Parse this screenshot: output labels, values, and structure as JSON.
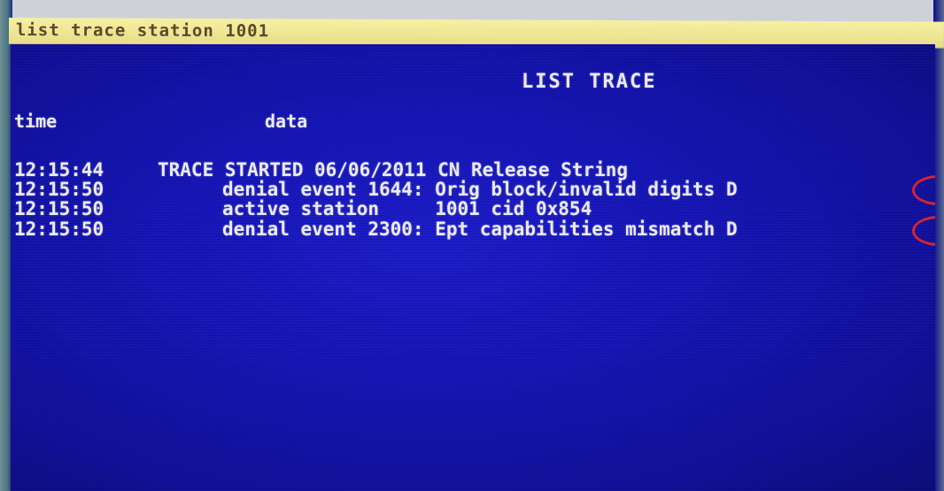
{
  "command_line": "list trace station 1001",
  "screen": {
    "title": "LIST TRACE",
    "columns": {
      "time": "time",
      "data": "data"
    },
    "rows": [
      {
        "time": "12:15:44",
        "data": "TRACE STARTED 06/06/2011 CN Release String"
      },
      {
        "time": "12:15:50",
        "data": "denial event 1644: Orig block/invalid digits D"
      },
      {
        "time": "12:15:50",
        "data": "active station     1001 cid 0x854"
      },
      {
        "time": "12:15:50",
        "data": "denial event 2300: Ept capabilities mismatch D"
      }
    ]
  },
  "colors": {
    "screen_background": "#1212b1",
    "text": "#ececf0",
    "command_bar": "#f6f0a3",
    "highlight": "#d52030"
  }
}
